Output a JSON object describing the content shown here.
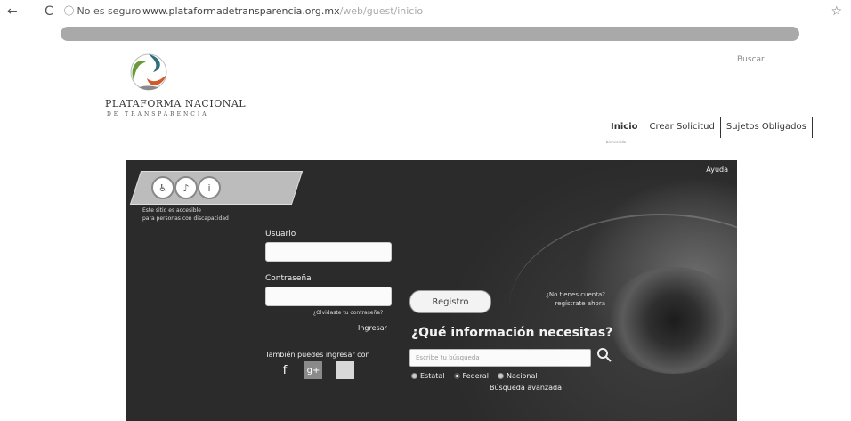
{
  "browser": {
    "back_icon": "←",
    "reload_icon": "C",
    "security_label": "ⓘ No es seguro",
    "url": "www.plataformadetransparencia.org.mx",
    "url_tail": "/web/guest/inicio",
    "bookmark_icon": "☆"
  },
  "header": {
    "logo_title": "PLATAFORMA NACIONAL",
    "logo_subtitle": "DE TRANSPARENCIA",
    "top_right": "Buscar",
    "nav": [
      {
        "label": "Inicio"
      },
      {
        "label": "Crear Solicitud"
      },
      {
        "label": "Sujetos Obligados"
      }
    ],
    "nav_note": "bienvenido"
  },
  "hero": {
    "help_link": "Ayuda",
    "note": "Este sitio es accesible\npara personas con discapacidad",
    "login": {
      "user_label": "Usuario",
      "password_label": "Contraseña",
      "forgot_label": "¿Olvidaste tu contraseña?",
      "login_label": "Ingresar",
      "also_label": "También puedes ingresar con",
      "social": {
        "facebook": "f",
        "google": "g+"
      }
    },
    "register": {
      "button_label": "Registro",
      "note": "¿No tienes cuenta?\nregístrate ahora"
    },
    "search": {
      "question": "¿Qué información necesitas?",
      "placeholder": "Escribe tu búsqueda",
      "radios": [
        {
          "label": "Estatal",
          "selected": false
        },
        {
          "label": "Federal",
          "selected": true
        },
        {
          "label": "Nacional",
          "selected": false
        }
      ],
      "advanced_label": "Búsqueda avanzada"
    }
  }
}
